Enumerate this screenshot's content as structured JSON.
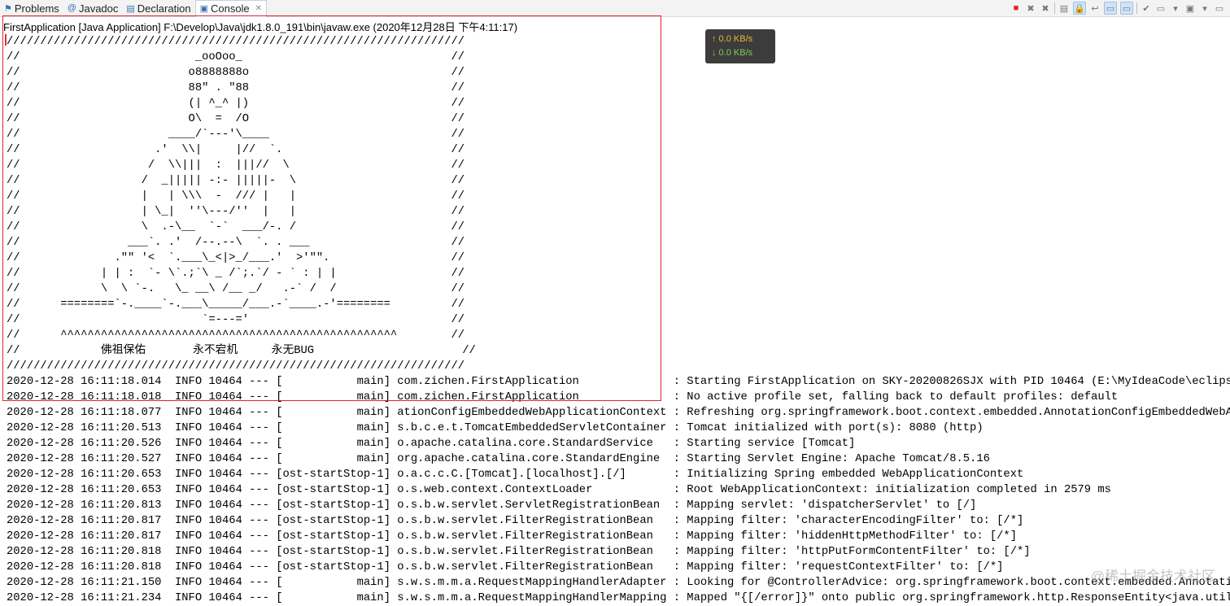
{
  "tabs": [
    {
      "label": "Problems",
      "icon": "problems-icon",
      "glyph": "⚑"
    },
    {
      "label": "Javadoc",
      "icon": "javadoc-icon",
      "glyph": "@"
    },
    {
      "label": "Declaration",
      "icon": "declaration-icon",
      "glyph": "▤"
    },
    {
      "label": "Console",
      "icon": "console-icon",
      "glyph": "▣",
      "active": true,
      "close": "✕"
    }
  ],
  "toolbar": [
    {
      "name": "terminate-icon",
      "glyph": "■",
      "color": "#e0262d"
    },
    {
      "name": "remove-launch-icon",
      "glyph": "✖"
    },
    {
      "name": "remove-all-terminated-icon",
      "glyph": "✖"
    },
    {
      "name": "clear-console-icon",
      "glyph": "▤"
    },
    {
      "name": "scroll-lock-icon",
      "glyph": "🔒",
      "on": true
    },
    {
      "name": "word-wrap-icon",
      "glyph": "↩"
    },
    {
      "name": "show-on-stdout-icon",
      "glyph": "▭",
      "on": true
    },
    {
      "name": "show-on-stderr-icon",
      "glyph": "▭",
      "on": true
    },
    {
      "name": "pin-console-icon",
      "glyph": "✔"
    },
    {
      "name": "display-console-icon",
      "glyph": "▭"
    },
    {
      "name": "display-console-dropdown-icon",
      "glyph": "▾"
    },
    {
      "name": "open-console-icon",
      "glyph": "▣"
    },
    {
      "name": "open-console-dropdown-icon",
      "glyph": "▾"
    },
    {
      "name": "minimize-icon",
      "glyph": "▭"
    }
  ],
  "header": "FirstApplication [Java Application] F:\\Develop\\Java\\jdk1.8.0_191\\bin\\javaw.exe (2020年12月28日 下午4:11:17)",
  "net": {
    "up": "↑ 0.0 KB/s",
    "down": "↓ 0.0 KB/s"
  },
  "banner": [
    "////////////////////////////////////////////////////////////////////",
    "//                          _ooOoo_                               //",
    "//                         o8888888o                              //",
    "//                         88\" . \"88                              //",
    "//                         (| ^_^ |)                              //",
    "//                         O\\  =  /O                              //",
    "//                      ____/`---'\\____                           //",
    "//                    .'  \\\\|     |//  `.                         //",
    "//                   /  \\\\|||  :  |||//  \\                        //",
    "//                  /  _||||| -:- |||||-  \\                       //",
    "//                  |   | \\\\\\  -  /// |   |                       //",
    "//                  | \\_|  ''\\---/''  |   |                       //",
    "//                  \\  .-\\__  `-`  ___/-. /                       //",
    "//                ___`. .'  /--.--\\  `. . ___                     //",
    "//              .\"\" '<  `.___\\_<|>_/___.'  >'\"\".                  //",
    "//            | | :  `- \\`.;`\\ _ /`;.`/ - ` : | |                 //",
    "//            \\  \\ `-.   \\_ __\\ /__ _/   .-` /  /                 //",
    "//      ========`-.____`-.___\\_____/___.-`____.-'========         //",
    "//                           `=---='                              //",
    "//      ^^^^^^^^^^^^^^^^^^^^^^^^^^^^^^^^^^^^^^^^^^^^^^^^^^        //",
    "//            佛祖保佑       永不宕机     永无BUG                      //",
    "////////////////////////////////////////////////////////////////////"
  ],
  "logs": [
    {
      "ts": "2020-12-28 16:11:18.014",
      "level": "INFO",
      "pid": "10464",
      "thread": "main",
      "logger": "com.zichen.FirstApplication",
      "msg": "Starting FirstApplication on SKY-20200826SJX with PID 10464 (E:\\MyIdeaCode\\eclips"
    },
    {
      "ts": "2020-12-28 16:11:18.018",
      "level": "INFO",
      "pid": "10464",
      "thread": "main",
      "logger": "com.zichen.FirstApplication",
      "msg": "No active profile set, falling back to default profiles: default"
    },
    {
      "ts": "2020-12-28 16:11:18.077",
      "level": "INFO",
      "pid": "10464",
      "thread": "main",
      "logger": "ationConfigEmbeddedWebApplicationContext",
      "msg": "Refreshing org.springframework.boot.context.embedded.AnnotationConfigEmbeddedWebA"
    },
    {
      "ts": "2020-12-28 16:11:20.513",
      "level": "INFO",
      "pid": "10464",
      "thread": "main",
      "logger": "s.b.c.e.t.TomcatEmbeddedServletContainer",
      "msg": "Tomcat initialized with port(s): 8080 (http)"
    },
    {
      "ts": "2020-12-28 16:11:20.526",
      "level": "INFO",
      "pid": "10464",
      "thread": "main",
      "logger": "o.apache.catalina.core.StandardService",
      "msg": "Starting service [Tomcat]"
    },
    {
      "ts": "2020-12-28 16:11:20.527",
      "level": "INFO",
      "pid": "10464",
      "thread": "main",
      "logger": "org.apache.catalina.core.StandardEngine",
      "msg": "Starting Servlet Engine: Apache Tomcat/8.5.16"
    },
    {
      "ts": "2020-12-28 16:11:20.653",
      "level": "INFO",
      "pid": "10464",
      "thread": "ost-startStop-1",
      "logger": "o.a.c.c.C.[Tomcat].[localhost].[/]",
      "msg": "Initializing Spring embedded WebApplicationContext"
    },
    {
      "ts": "2020-12-28 16:11:20.653",
      "level": "INFO",
      "pid": "10464",
      "thread": "ost-startStop-1",
      "logger": "o.s.web.context.ContextLoader",
      "msg": "Root WebApplicationContext: initialization completed in 2579 ms"
    },
    {
      "ts": "2020-12-28 16:11:20.813",
      "level": "INFO",
      "pid": "10464",
      "thread": "ost-startStop-1",
      "logger": "o.s.b.w.servlet.ServletRegistrationBean",
      "msg": "Mapping servlet: 'dispatcherServlet' to [/]"
    },
    {
      "ts": "2020-12-28 16:11:20.817",
      "level": "INFO",
      "pid": "10464",
      "thread": "ost-startStop-1",
      "logger": "o.s.b.w.servlet.FilterRegistrationBean",
      "msg": "Mapping filter: 'characterEncodingFilter' to: [/*]"
    },
    {
      "ts": "2020-12-28 16:11:20.817",
      "level": "INFO",
      "pid": "10464",
      "thread": "ost-startStop-1",
      "logger": "o.s.b.w.servlet.FilterRegistrationBean",
      "msg": "Mapping filter: 'hiddenHttpMethodFilter' to: [/*]"
    },
    {
      "ts": "2020-12-28 16:11:20.818",
      "level": "INFO",
      "pid": "10464",
      "thread": "ost-startStop-1",
      "logger": "o.s.b.w.servlet.FilterRegistrationBean",
      "msg": "Mapping filter: 'httpPutFormContentFilter' to: [/*]"
    },
    {
      "ts": "2020-12-28 16:11:20.818",
      "level": "INFO",
      "pid": "10464",
      "thread": "ost-startStop-1",
      "logger": "o.s.b.w.servlet.FilterRegistrationBean",
      "msg": "Mapping filter: 'requestContextFilter' to: [/*]"
    },
    {
      "ts": "2020-12-28 16:11:21.150",
      "level": "INFO",
      "pid": "10464",
      "thread": "main",
      "logger": "s.w.s.m.m.a.RequestMappingHandlerAdapter",
      "msg": "Looking for @ControllerAdvice: org.springframework.boot.context.embedded.Annotati"
    },
    {
      "ts": "2020-12-28 16:11:21.234",
      "level": "INFO",
      "pid": "10464",
      "thread": "main",
      "logger": "s.w.s.m.m.a.RequestMappingHandlerMapping",
      "msg": "Mapped \"{[/error]}\" onto public org.springframework.http.ResponseEntity<java.util"
    }
  ],
  "watermark": "@稀土掘金技术社区"
}
